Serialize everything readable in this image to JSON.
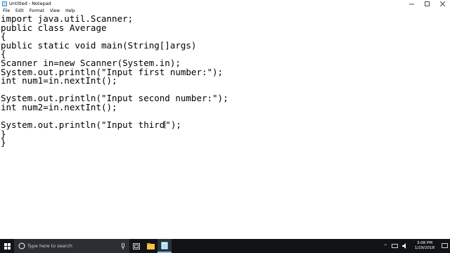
{
  "window": {
    "title": "Untitled - Notepad"
  },
  "menu": [
    "File",
    "Edit",
    "Format",
    "View",
    "Help"
  ],
  "editor": {
    "lines": [
      "import java.util.Scanner;",
      "public class Average",
      "{",
      "public static void main(String[]args)",
      "{",
      "Scanner in=new Scanner(System.in);",
      "System.out.println(\"Input first number:\");",
      "int num1=in.nextInt();",
      "",
      "System.out.println(\"Input second number:\");",
      "int num2=in.nextInt();",
      "",
      "System.out.println(\"Input third",
      "}",
      "}"
    ],
    "caret_line_suffix": "\");"
  },
  "taskbar": {
    "search_placeholder": "Type here to search",
    "clock_time": "3:08 PM",
    "clock_date": "1/29/2018"
  },
  "icons": {
    "app": "notepad-icon",
    "minimize": "minimize-icon",
    "maximize": "maximize-icon",
    "close": "close-icon",
    "start": "windows-start-icon",
    "search": "search-icon",
    "mic": "microphone-icon",
    "taskview": "task-view-icon",
    "explorer": "file-explorer-icon",
    "notepad": "notepad-taskbar-icon",
    "notification": "notification-icon"
  }
}
